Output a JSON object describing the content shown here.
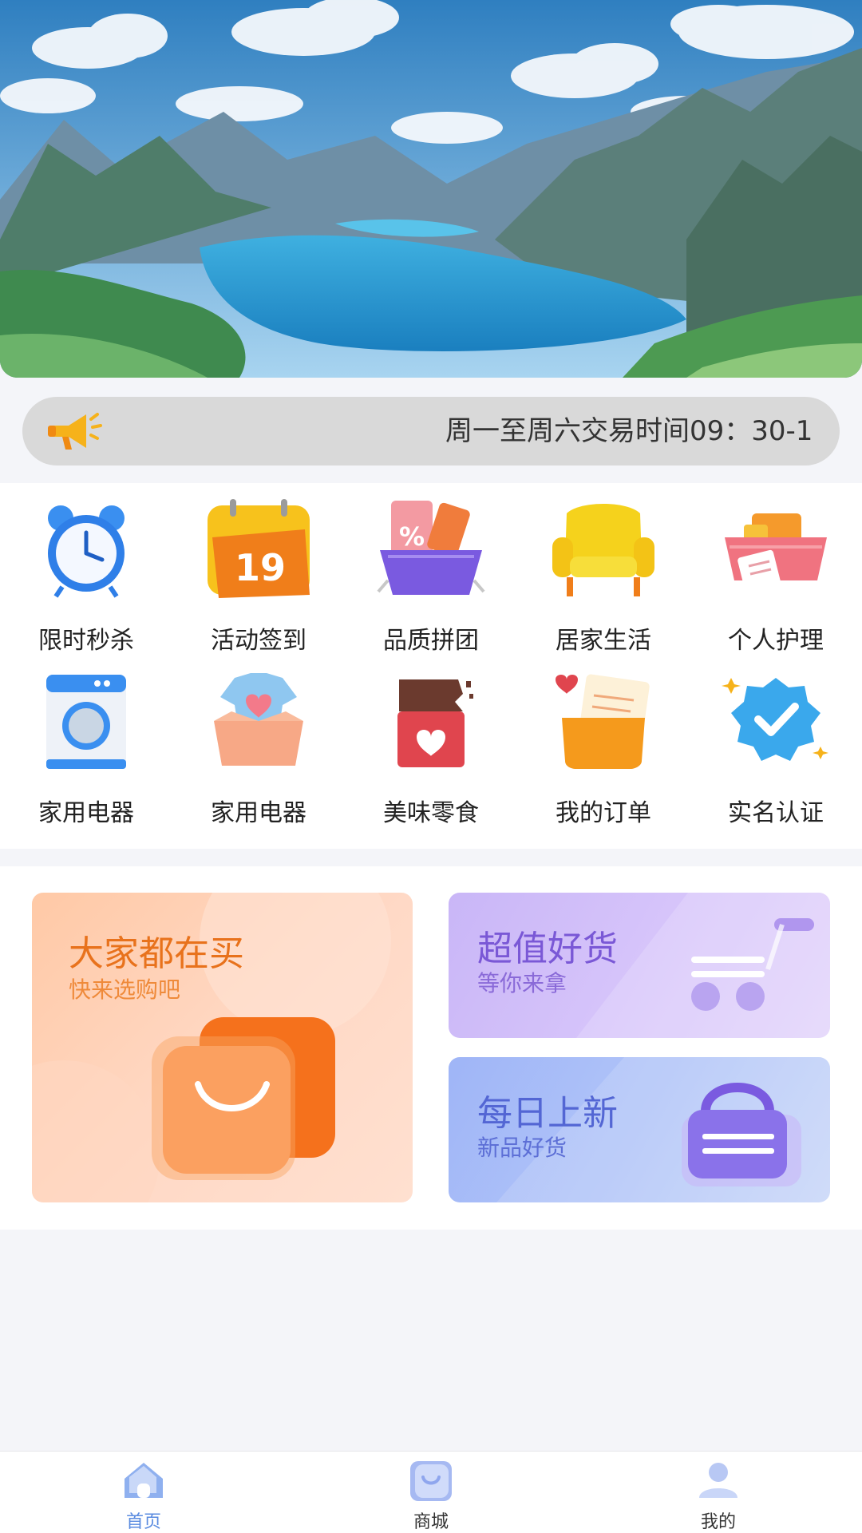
{
  "banner": {
    "icon": "landscape-image"
  },
  "notice": {
    "icon": "megaphone-icon",
    "text": "周一至周六交易时间09：30-1"
  },
  "categories": [
    {
      "label": "限时秒杀",
      "icon": "alarm-clock-icon"
    },
    {
      "label": "活动签到",
      "icon": "calendar-icon"
    },
    {
      "label": "品质拼团",
      "icon": "discount-basket-icon"
    },
    {
      "label": "居家生活",
      "icon": "armchair-icon"
    },
    {
      "label": "个人护理",
      "icon": "care-basket-icon"
    },
    {
      "label": "家用电器",
      "icon": "washing-machine-icon"
    },
    {
      "label": "家用电器",
      "icon": "clothes-box-icon"
    },
    {
      "label": "美味零食",
      "icon": "chocolate-icon"
    },
    {
      "label": "我的订单",
      "icon": "order-envelope-icon"
    },
    {
      "label": "实名认证",
      "icon": "verified-badge-icon"
    }
  ],
  "promos": {
    "popular": {
      "title": "大家都在买",
      "subtitle": "快来选购吧",
      "icon": "shopping-bag-icon"
    },
    "value": {
      "title": "超值好货",
      "subtitle": "等你来拿",
      "icon": "cart-icon"
    },
    "new": {
      "title": "每日上新",
      "subtitle": "新品好货",
      "icon": "handbag-icon"
    }
  },
  "tabbar": {
    "items": [
      {
        "label": "首页",
        "icon": "home-icon",
        "active": true
      },
      {
        "label": "商城",
        "icon": "shop-icon",
        "active": false
      },
      {
        "label": "我的",
        "icon": "profile-icon",
        "active": false
      }
    ]
  },
  "colors": {
    "tab_active": "#5a8be0",
    "tab_inactive": "#333333",
    "notice_bg": "#d9d9d9"
  }
}
